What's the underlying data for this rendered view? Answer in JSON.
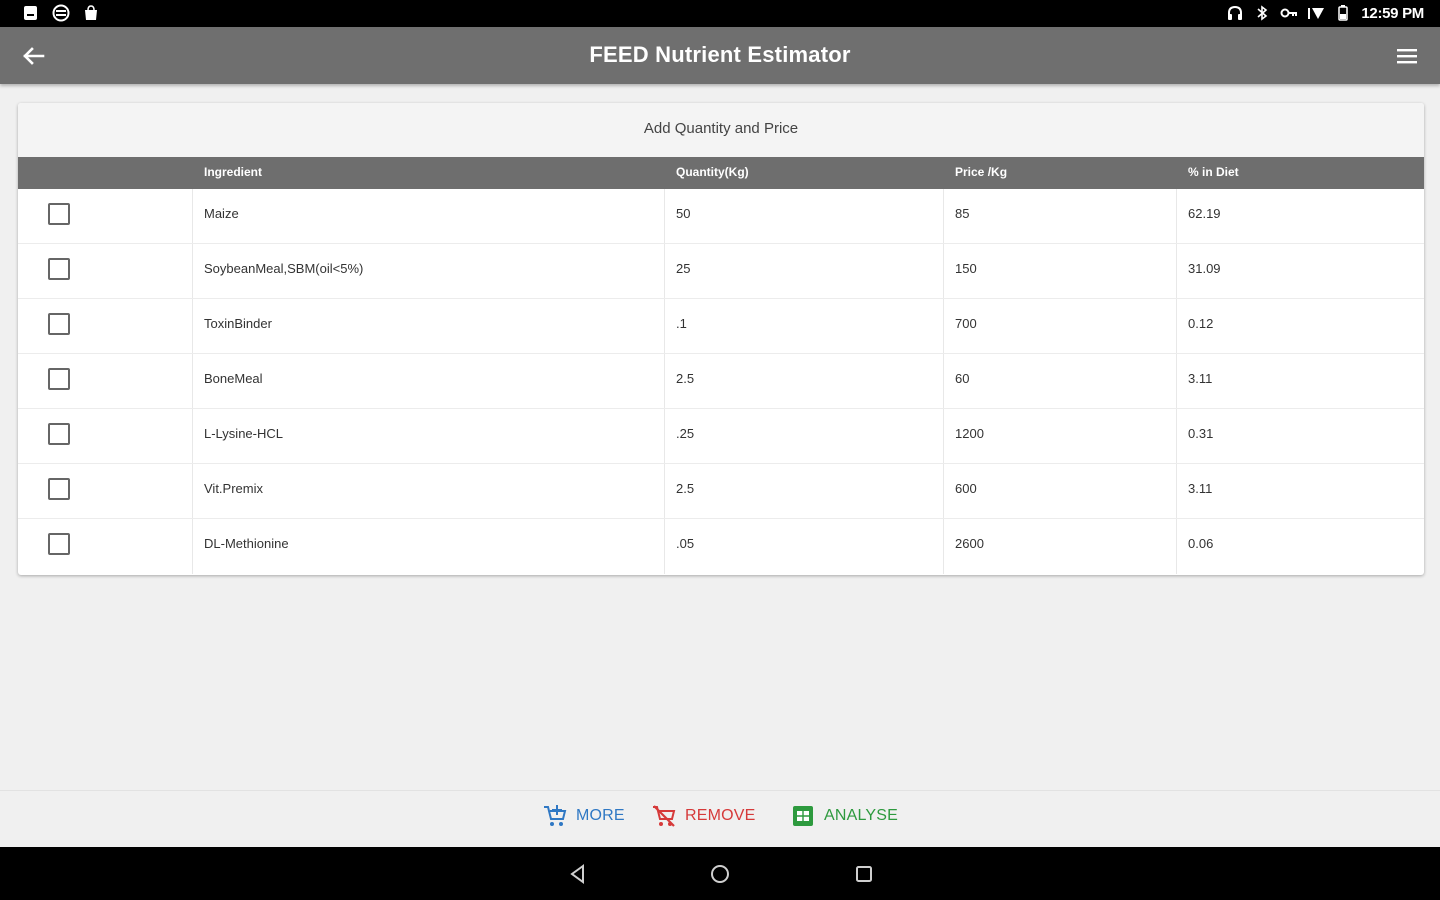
{
  "status_bar": {
    "time": "12:59 PM",
    "left_icons": [
      "sd-card-icon",
      "subtitles-icon",
      "shopping-bag-icon"
    ],
    "right_icons": [
      "headset-icon",
      "bluetooth-icon",
      "vpn-key-icon",
      "wifi-icon",
      "battery-icon"
    ]
  },
  "app_bar": {
    "title": "FEED Nutrient Estimator",
    "back_icon": "arrow-back-icon",
    "menu_icon": "hamburger-menu-icon",
    "color": "#6f6f6f"
  },
  "card": {
    "heading": "Add Quantity and Price",
    "columns": [
      "",
      "Ingredient",
      "Quantity(Kg)",
      "Price /Kg",
      "% in Diet"
    ],
    "rows": [
      {
        "ingredient": "Maize",
        "quantity": "50",
        "price": "85",
        "percent": "62.19"
      },
      {
        "ingredient": "SoybeanMeal,SBM(oil<5%)",
        "quantity": "25",
        "price": "150",
        "percent": "31.09"
      },
      {
        "ingredient": "ToxinBinder",
        "quantity": ".1",
        "price": "700",
        "percent": "0.12"
      },
      {
        "ingredient": "BoneMeal",
        "quantity": "2.5",
        "price": "60",
        "percent": "3.11"
      },
      {
        "ingredient": "L-Lysine-HCL",
        "quantity": ".25",
        "price": "1200",
        "percent": "0.31"
      },
      {
        "ingredient": "Vit.Premix",
        "quantity": "2.5",
        "price": "600",
        "percent": "3.11"
      },
      {
        "ingredient": "DL-Methionine",
        "quantity": ".05",
        "price": "2600",
        "percent": "0.06"
      }
    ]
  },
  "actions": {
    "more": {
      "label": "MORE",
      "icon": "add-cart-icon",
      "color": "#2f78c4"
    },
    "remove": {
      "label": "REMOVE",
      "icon": "remove-cart-icon",
      "color": "#d63a3a"
    },
    "analyse": {
      "label": "ANALYSE",
      "icon": "spreadsheet-icon",
      "color": "#2d9a3e"
    }
  },
  "nav_bar": {
    "icons": [
      "nav-back-icon",
      "nav-home-icon",
      "nav-recents-icon"
    ]
  }
}
